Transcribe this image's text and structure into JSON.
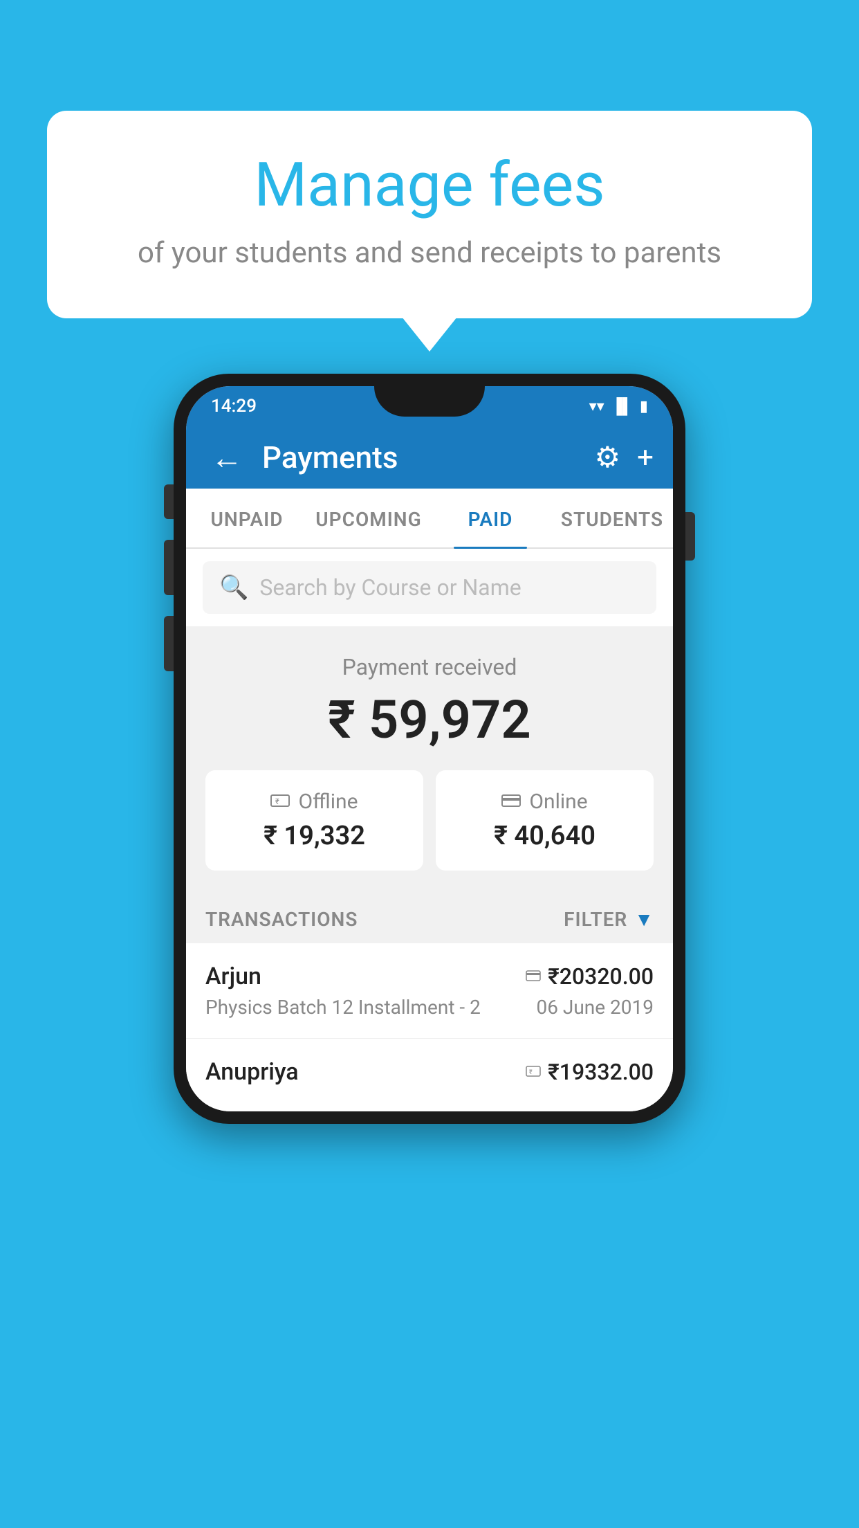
{
  "background_color": "#29b6e8",
  "speech_bubble": {
    "title": "Manage fees",
    "subtitle": "of your students and send receipts to parents"
  },
  "phone": {
    "status_bar": {
      "time": "14:29",
      "icons": [
        "▼",
        "▲",
        "▌"
      ]
    },
    "header": {
      "back_label": "←",
      "title": "Payments",
      "gear_icon": "⚙",
      "add_icon": "+"
    },
    "tabs": [
      {
        "label": "UNPAID",
        "active": false
      },
      {
        "label": "UPCOMING",
        "active": false
      },
      {
        "label": "PAID",
        "active": true
      },
      {
        "label": "STUDENTS",
        "active": false
      }
    ],
    "search": {
      "placeholder": "Search by Course or Name"
    },
    "payment_summary": {
      "label": "Payment received",
      "amount": "₹ 59,972",
      "offline": {
        "icon": "💳",
        "type": "Offline",
        "amount": "₹ 19,332"
      },
      "online": {
        "icon": "💳",
        "type": "Online",
        "amount": "₹ 40,640"
      }
    },
    "transactions": {
      "label": "TRANSACTIONS",
      "filter_label": "FILTER",
      "rows": [
        {
          "name": "Arjun",
          "detail": "Physics Batch 12 Installment - 2",
          "amount": "₹20320.00",
          "date": "06 June 2019",
          "payment_icon": "💳"
        },
        {
          "name": "Anupriya",
          "detail": "",
          "amount": "₹19332.00",
          "date": "",
          "payment_icon": "💴"
        }
      ]
    }
  }
}
